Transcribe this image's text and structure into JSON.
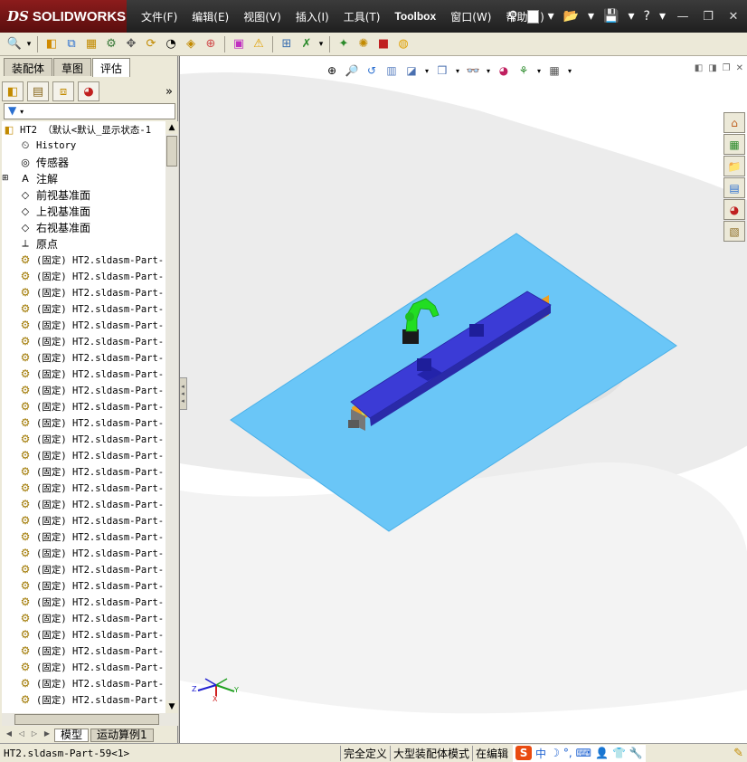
{
  "app": {
    "logo_ds": "DS",
    "logo_name": "SOLIDWORKS"
  },
  "menu": [
    {
      "label": "文件(F)",
      "name": "menu-file"
    },
    {
      "label": "编辑(E)",
      "name": "menu-edit"
    },
    {
      "label": "视图(V)",
      "name": "menu-view"
    },
    {
      "label": "插入(I)",
      "name": "menu-insert"
    },
    {
      "label": "工具(T)",
      "name": "menu-tools"
    },
    {
      "label": "Toolbox",
      "name": "menu-toolbox"
    },
    {
      "label": "窗口(W)",
      "name": "menu-window"
    },
    {
      "label": "帮助(H)",
      "name": "menu-help"
    }
  ],
  "tabs": [
    {
      "label": "装配体",
      "name": "tab-assembly"
    },
    {
      "label": "草图",
      "name": "tab-sketch"
    },
    {
      "label": "评估",
      "name": "tab-evaluate"
    }
  ],
  "tree": {
    "root_label": "HT2 （默认<默认_显示状态-1",
    "items": [
      {
        "label": "History",
        "icon": "history-icon",
        "expand": "",
        "mono": true
      },
      {
        "label": "传感器",
        "icon": "sensor-icon",
        "expand": "",
        "mono": false
      },
      {
        "label": "注解",
        "icon": "annotation-icon",
        "expand": "⊞",
        "mono": false
      },
      {
        "label": "前视基准面",
        "icon": "plane-icon",
        "expand": "",
        "mono": false
      },
      {
        "label": "上视基准面",
        "icon": "plane-icon",
        "expand": "",
        "mono": false
      },
      {
        "label": "右视基准面",
        "icon": "plane-icon",
        "expand": "",
        "mono": false
      },
      {
        "label": "原点",
        "icon": "origin-icon",
        "expand": "",
        "mono": false
      }
    ],
    "part_label": "(固定) HT2.sldasm-Part-",
    "part_count": 28
  },
  "bottom_tabs": [
    {
      "label": "模型",
      "name": "bottom-tab-model"
    },
    {
      "label": "运动算例1",
      "name": "bottom-tab-motion-study"
    }
  ],
  "triad": {
    "x": "X",
    "y": "Y",
    "z": "Z"
  },
  "status": {
    "selected": "HT2.sldasm-Part-59<1>",
    "defined": "完全定义",
    "mode": "大型装配体模式",
    "editing": "在编辑",
    "ime_brand": "S",
    "ime_lang": "中"
  },
  "colors": {
    "floor": "#6ac6f7",
    "rail_top": "#3b3bd6",
    "rail_side": "#f0a020",
    "robot": "#22dd22",
    "title_bg": "#2a2a2a",
    "logo_bg": "#7a1414"
  }
}
